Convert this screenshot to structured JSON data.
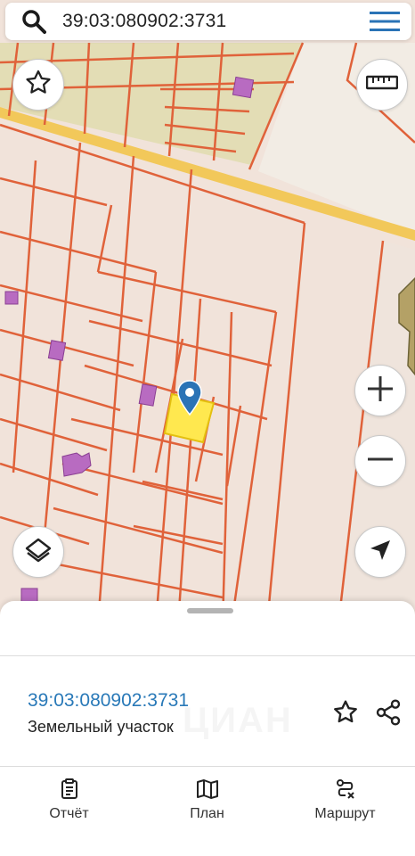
{
  "search": {
    "query": "39:03:080902:3731"
  },
  "map": {
    "colors": {
      "background": "#f1e3da",
      "boundary": "#e0623a",
      "selected_fill": "#ffe84f",
      "marker": "#2a73b6",
      "building": "#b86bc1",
      "road": "#f2c85a"
    }
  },
  "icons": {
    "search": "search-icon",
    "menu": "menu-icon",
    "favorite": "star-icon",
    "ruler": "ruler-icon",
    "zoom_in": "plus-icon",
    "zoom_out": "minus-icon",
    "layers": "layers-icon",
    "locate": "navigation-arrow-icon"
  },
  "object": {
    "cadastral_number": "39:03:080902:3731",
    "type": "Земельный участок"
  },
  "watermark": "ЦИАН",
  "tabs": [
    {
      "label": "Отчёт",
      "icon": "report-icon"
    },
    {
      "label": "План",
      "icon": "map-plan-icon"
    },
    {
      "label": "Маршрут",
      "icon": "route-icon"
    }
  ]
}
